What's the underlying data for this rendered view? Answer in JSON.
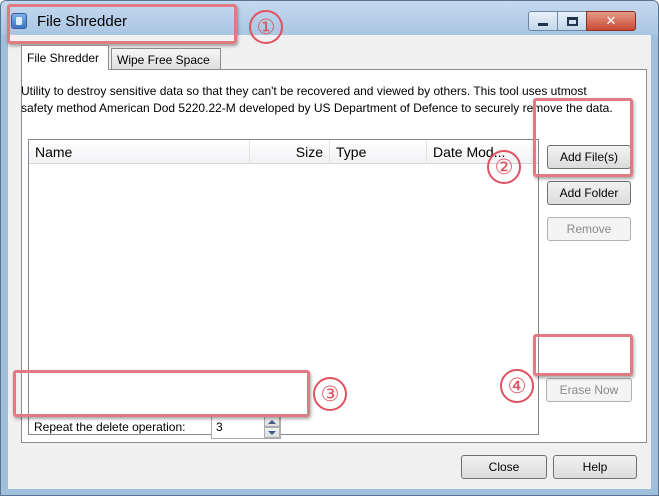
{
  "window": {
    "title": "File Shredder",
    "close_glyph": "✕"
  },
  "tabs": [
    {
      "label": "File Shredder",
      "active": true
    },
    {
      "label": "Wipe Free Space",
      "active": false
    }
  ],
  "description": "Utility to destroy sensitive data so that they can't be recovered and viewed by others. This tool uses utmost safety method American Dod 5220.22-M developed by US Department of Defence to securely remove the data.",
  "file_list": {
    "columns": [
      "Name",
      "Size",
      "Type",
      "Date Mod..."
    ],
    "rows": []
  },
  "side_buttons": {
    "add_files": "Add File(s)",
    "add_folder": "Add Folder",
    "remove": "Remove",
    "erase_now": "Erase Now"
  },
  "repeat": {
    "label": "Repeat the delete operation:",
    "value": "3"
  },
  "footer_buttons": {
    "close": "Close",
    "help": "Help"
  },
  "callouts": [
    "①",
    "②",
    "③",
    "④"
  ],
  "colors": {
    "callout": "#e05260",
    "callout_box": "#e07b84",
    "title_bar": "#b7d0ea"
  }
}
